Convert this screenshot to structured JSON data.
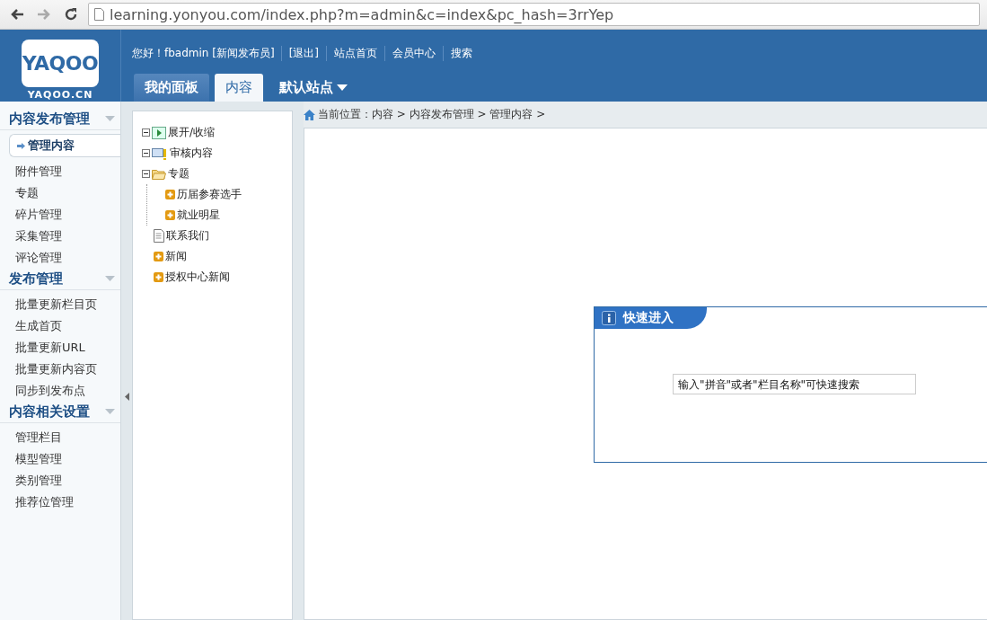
{
  "browser": {
    "url": "learning.yonyou.com/index.php?m=admin&c=index&pc_hash=3rrYep"
  },
  "header": {
    "logo": "YAQOO",
    "logo_caption": "YAQOO.CN",
    "greeting": "您好！fbadmin [新闻发布员]",
    "links": [
      "[退出]",
      "站点首页",
      "会员中心",
      "搜索"
    ],
    "tabs": [
      {
        "label": "我的面板",
        "selected": false,
        "kind": "tab"
      },
      {
        "label": "内容",
        "selected": true,
        "kind": "tab"
      },
      {
        "label": "默认站点",
        "selected": false,
        "kind": "dropdown"
      }
    ]
  },
  "sidebar": {
    "groups": [
      {
        "title": "内容发布管理",
        "items": [
          {
            "label": "管理内容",
            "selected": true
          },
          {
            "label": "附件管理",
            "selected": false
          },
          {
            "label": "专题",
            "selected": false
          },
          {
            "label": "碎片管理",
            "selected": false
          },
          {
            "label": "采集管理",
            "selected": false
          },
          {
            "label": "评论管理",
            "selected": false
          }
        ]
      },
      {
        "title": "发布管理",
        "items": [
          {
            "label": "批量更新栏目页",
            "selected": false
          },
          {
            "label": "生成首页",
            "selected": false
          },
          {
            "label": "批量更新URL",
            "selected": false
          },
          {
            "label": "批量更新内容页",
            "selected": false
          },
          {
            "label": "同步到发布点",
            "selected": false
          }
        ]
      },
      {
        "title": "内容相关设置",
        "items": [
          {
            "label": "管理栏目",
            "selected": false
          },
          {
            "label": "模型管理",
            "selected": false
          },
          {
            "label": "类别管理",
            "selected": false
          },
          {
            "label": "推荐位管理",
            "selected": false
          }
        ]
      }
    ]
  },
  "tree": [
    {
      "label": "展开/收缩",
      "kind": "toggle",
      "expanded": true
    },
    {
      "label": "审核内容",
      "kind": "review",
      "expanded": true
    },
    {
      "label": "专题",
      "kind": "folder",
      "expanded": true,
      "children": [
        {
          "label": "历届参赛选手",
          "kind": "plus"
        },
        {
          "label": "就业明星",
          "kind": "plus"
        }
      ]
    },
    {
      "label": "联系我们",
      "kind": "page",
      "expanded": false
    },
    {
      "label": "新闻",
      "kind": "plus",
      "expanded": false
    },
    {
      "label": "授权中心新闻",
      "kind": "plus",
      "expanded": false
    }
  ],
  "breadcrumb": "当前位置：内容 > 内容发布管理 > 管理内容 >",
  "quick_enter": {
    "title": "快速进入",
    "placeholder": "输入\"拼音\"或者\"栏目名称\"可快速搜索"
  }
}
